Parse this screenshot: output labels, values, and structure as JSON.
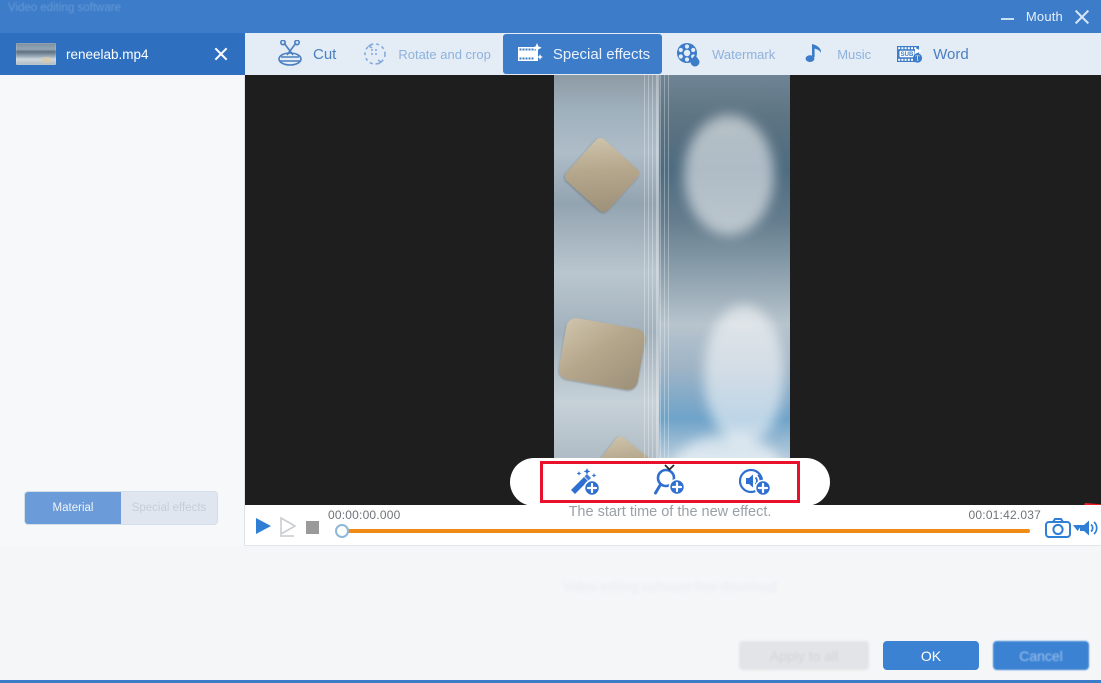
{
  "window": {
    "ghost_title": "Video editing software",
    "minimize_label": "minimize",
    "mouth_label": "Mouth",
    "close_label": "close"
  },
  "file_tab": {
    "name": "reneelab.mp4",
    "close_label": "×"
  },
  "toolbar": {
    "tabs": [
      {
        "label": "Cut",
        "icon": "scissors-icon",
        "active": false
      },
      {
        "label": "Rotate and crop",
        "icon": "rotate-icon",
        "active": false
      },
      {
        "label": "Special effects",
        "icon": "film-sparkle-icon",
        "active": true
      },
      {
        "label": "Watermark",
        "icon": "film-droplet-icon",
        "active": false
      },
      {
        "label": "Music",
        "icon": "music-note-icon",
        "active": false
      },
      {
        "label": "Word",
        "icon": "subtitle-icon",
        "active": false
      }
    ]
  },
  "left_panel": {
    "tabs": [
      {
        "label": "Material",
        "active": true
      },
      {
        "label": "Special effects",
        "active": false
      }
    ]
  },
  "effect_bar": {
    "buttons": [
      {
        "name": "add-filter-effect",
        "icon": "magic-wand-plus-icon"
      },
      {
        "name": "add-zoom-effect",
        "icon": "magnifier-plus-icon"
      },
      {
        "name": "add-volume-effect",
        "icon": "speaker-plus-icon"
      }
    ],
    "collapse_icon": "chevron-down-icon"
  },
  "transport": {
    "play_label": "play",
    "step_label": "step-forward",
    "stop_label": "stop",
    "current_time": "00:00:00.000",
    "total_time": "00:01:42.037",
    "snapshot_label": "snapshot",
    "volume_label": "volume"
  },
  "hint": {
    "text": "The start time of the new effect."
  },
  "bottom": {
    "ghost_text": "Video editing software free download",
    "apply_all_label": "Apply to all",
    "ok_label": "OK",
    "cancel_label": "Cancel"
  },
  "colors": {
    "titlebar": "#3c7cc9",
    "accent": "#3c82d3",
    "toolbar_bg": "#e4ecf6",
    "timeline": "#f08b16",
    "annotation_red": "#e8102a",
    "stage_bg": "#1e1e1e"
  }
}
